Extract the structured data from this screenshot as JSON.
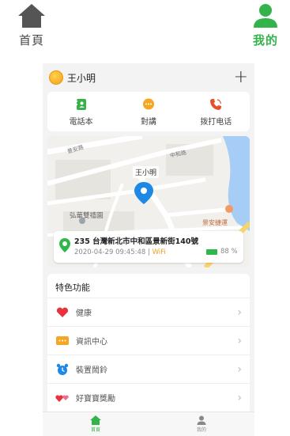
{
  "topnav": {
    "home_label": "首頁",
    "me_label": "我的"
  },
  "header": {
    "username": "王小明",
    "add_label": "+"
  },
  "quick_actions": [
    {
      "label": "電話本",
      "icon": "contacts-icon"
    },
    {
      "label": "對講",
      "icon": "chat-icon"
    },
    {
      "label": "拨打电话",
      "icon": "phone-call-icon"
    }
  ],
  "map": {
    "pin_label": "王小明",
    "street_labels": [
      "中和路",
      "景安路",
      "景安捷運",
      "弘華雙禧園"
    ],
    "address": "235 台灣新北市中和區景新街140號",
    "timestamp": "2020-04-29 09:45:48",
    "separator": "|",
    "network": "WiFi",
    "battery": "88 %",
    "battery_level": 0.88
  },
  "features": {
    "title": "特色功能",
    "items": [
      {
        "label": "健康",
        "icon": "heart-icon"
      },
      {
        "label": "資訊中心",
        "icon": "message-icon"
      },
      {
        "label": "裝置鬧鈴",
        "icon": "alarm-clock-icon"
      },
      {
        "label": "好寶寶獎勵",
        "icon": "hearts-reward-icon"
      }
    ],
    "chevron": "›"
  },
  "bottomnav": {
    "home_label": "首頁",
    "me_label": "我的"
  },
  "colors": {
    "accent_green": "#35b34a",
    "map_pin_blue": "#1e88e5",
    "warning_orange": "#f0a020"
  }
}
